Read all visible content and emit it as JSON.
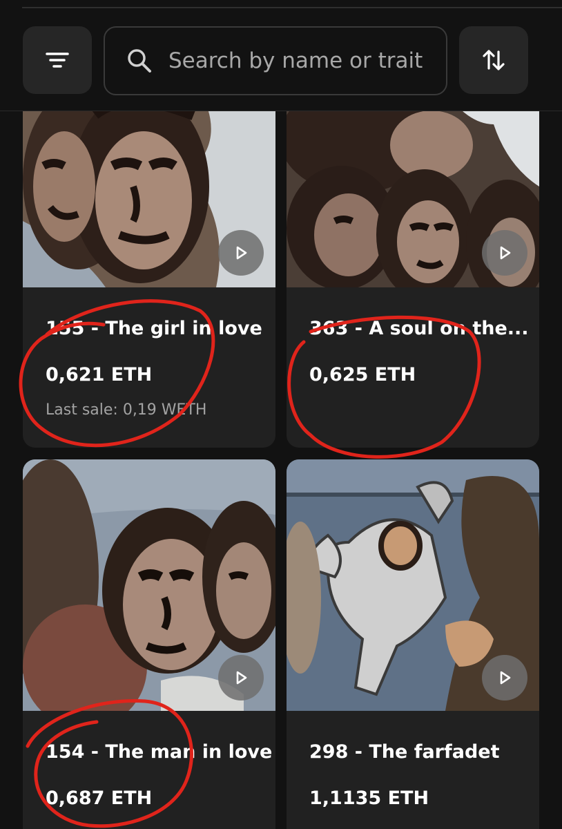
{
  "toolbar": {
    "filter_icon": "filter-lines-icon",
    "search_placeholder": "Search by name or trait",
    "search_icon": "search-icon",
    "sort_icon": "sort-arrows-icon"
  },
  "items": [
    {
      "name": "155 - The girl in love",
      "price": "0,621 ETH",
      "last_sale": "Last sale: 0,19 WETH"
    },
    {
      "name": "363 - A soul on the...",
      "price": "0,625 ETH",
      "last_sale": ""
    },
    {
      "name": "154 - The man in love",
      "price": "0,687 ETH",
      "last_sale": ""
    },
    {
      "name": "298 - The farfadet",
      "price": "1,1135 ETH",
      "last_sale": ""
    }
  ],
  "colors": {
    "background": "#121212",
    "card": "#212121",
    "annotation_red": "#e0241b"
  }
}
